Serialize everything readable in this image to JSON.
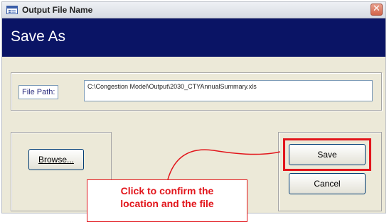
{
  "window": {
    "title": "Output File Name",
    "close_glyph": "✕"
  },
  "header": {
    "title": "Save As",
    "band_color": "#0a1465"
  },
  "file_path": {
    "label": "File Path:",
    "value": "C:\\Congestion Model\\Output\\2030_CTYAnnualSummary.xls"
  },
  "buttons": {
    "browse_label": "Browse...",
    "save_label": "Save",
    "cancel_label": "Cancel"
  },
  "annotation": {
    "line1": "Click to confirm the",
    "line2": "location and the file",
    "color": "#e2151b"
  }
}
